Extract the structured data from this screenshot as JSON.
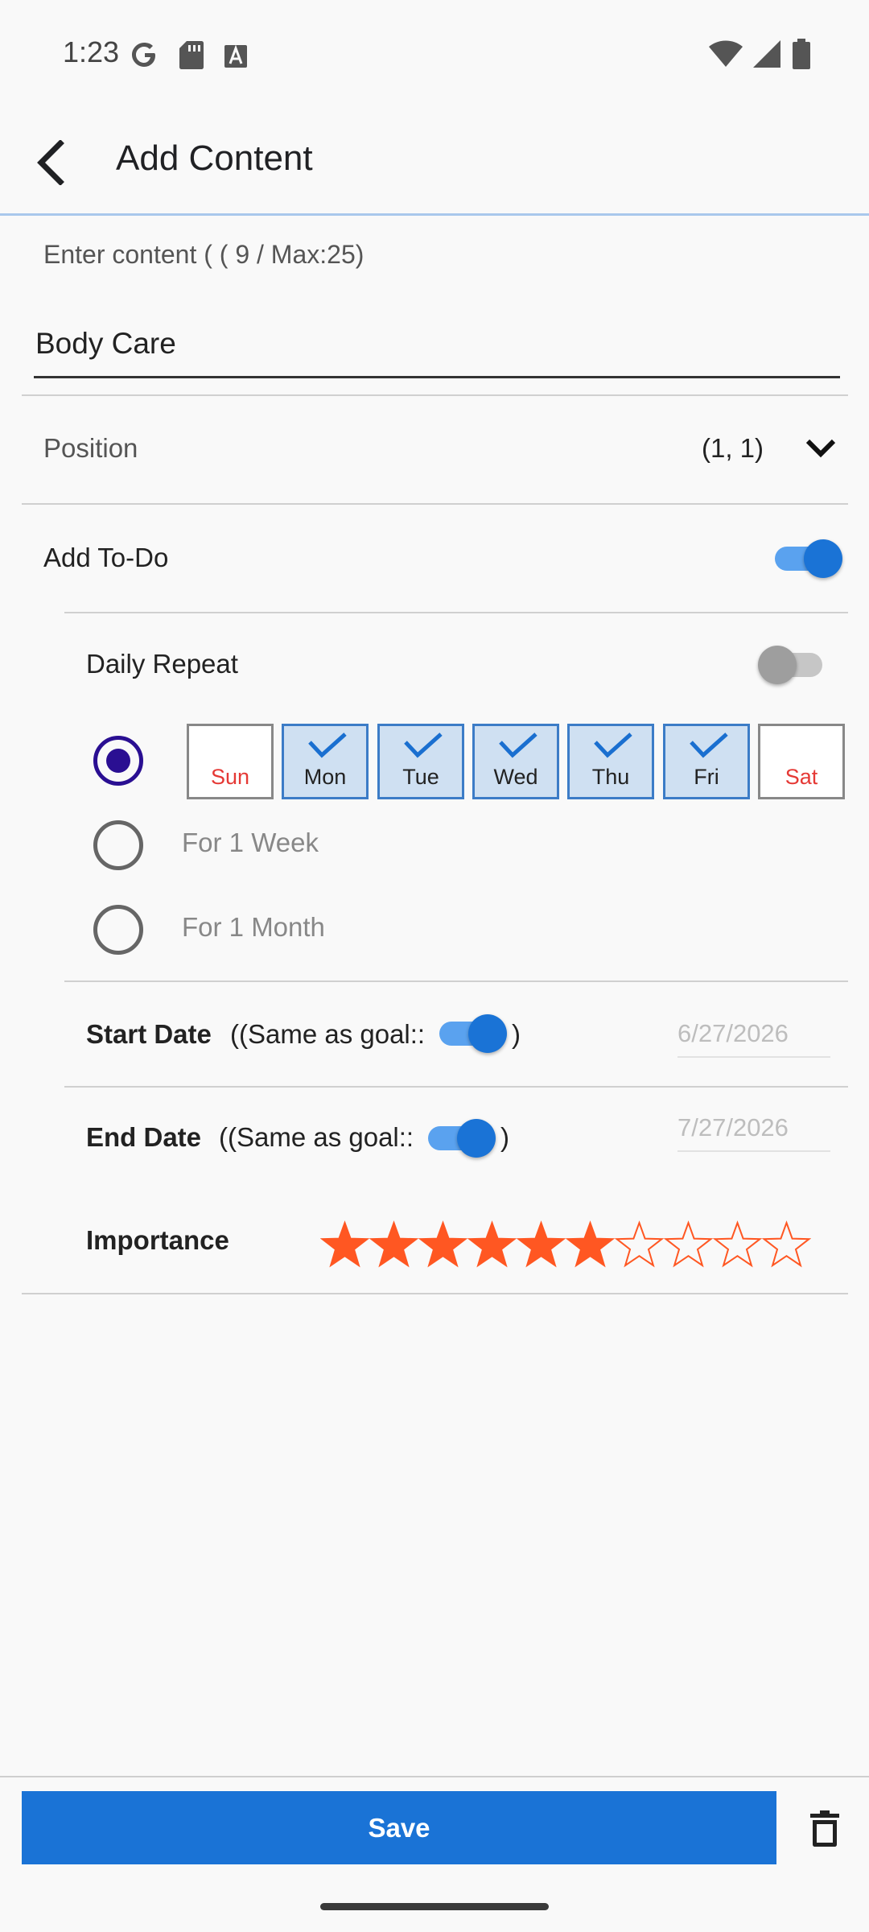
{
  "status_bar": {
    "time": "1:23",
    "left_icons": [
      "google-icon",
      "sd-card-icon",
      "text-a-icon"
    ],
    "right_icons": [
      "wifi-icon",
      "signal-icon",
      "battery-icon"
    ]
  },
  "app_bar": {
    "title": "Add Content",
    "back_icon": "arrow-back-icon"
  },
  "content": {
    "hint": "Enter content ( ( 9 / Max:25)",
    "value": "Body Care"
  },
  "position": {
    "label": "Position",
    "value": "(1, 1)",
    "icon": "chevron-down-icon"
  },
  "todo": {
    "label": "Add To-Do",
    "enabled": true
  },
  "daily_repeat": {
    "label": "Daily Repeat",
    "enabled": false
  },
  "repeat_options": {
    "selected_index": 0,
    "days": [
      {
        "label": "Sun",
        "checked": false,
        "weekend": true
      },
      {
        "label": "Mon",
        "checked": true,
        "weekend": false
      },
      {
        "label": "Tue",
        "checked": true,
        "weekend": false
      },
      {
        "label": "Wed",
        "checked": true,
        "weekend": false
      },
      {
        "label": "Thu",
        "checked": true,
        "weekend": false
      },
      {
        "label": "Fri",
        "checked": true,
        "weekend": false
      },
      {
        "label": "Sat",
        "checked": false,
        "weekend": true
      }
    ],
    "week_label": "For 1 Week",
    "month_label": "For 1 Month"
  },
  "start_date": {
    "label": "Start Date",
    "same_as_goal_label": "((Same as goal::",
    "close_paren": ")",
    "same_as_goal": true,
    "value": "6/27/2026"
  },
  "end_date": {
    "label": "End Date",
    "same_as_goal_label": "((Same as goal::",
    "close_paren": ")",
    "same_as_goal": true,
    "value": "7/27/2026"
  },
  "importance": {
    "label": "Importance",
    "rating": 6,
    "max": 10,
    "color": "#ff5722"
  },
  "footer": {
    "save_label": "Save",
    "delete_icon": "trash-icon"
  },
  "colors": {
    "accent": "#1a73d6",
    "radio": "#2a0f92",
    "weekend": "#e53935"
  }
}
